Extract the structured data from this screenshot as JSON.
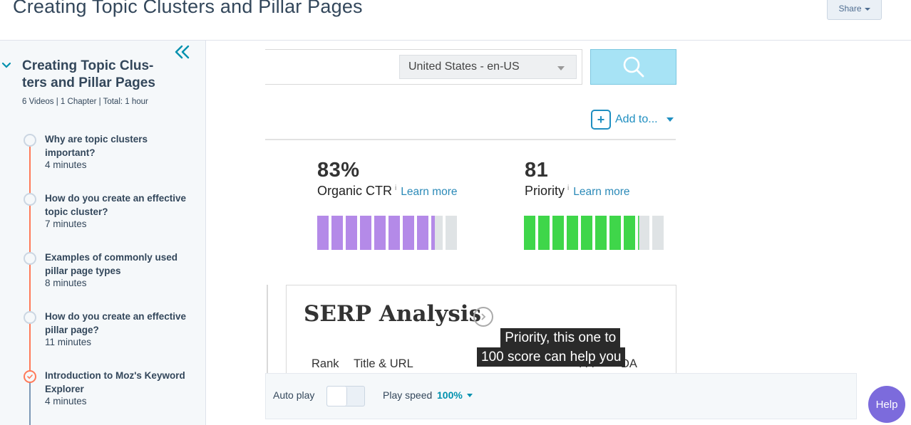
{
  "header": {
    "title": "Creating Topic Clusters and Pillar Pages",
    "share_label": "Share"
  },
  "sidebar": {
    "course_title": "Creating Topic Clus-ters and Pillar Pages",
    "course_title_line1": "Creating Topic Clus-",
    "course_title_line2": "ters and Pillar Pages",
    "meta": "6 Videos | 1 Chapter | Total: 1 hour",
    "lessons": [
      {
        "title": "Why are topic clusters important?",
        "duration": "4 minutes",
        "status": "pending"
      },
      {
        "title": "How do you create an effective topic cluster?",
        "duration": "7 minutes",
        "status": "pending"
      },
      {
        "title": "Examples of commonly used pillar page types",
        "duration": "8 minutes",
        "status": "pending"
      },
      {
        "title": "How do you create an effective pillar page?",
        "duration": "11 minutes",
        "status": "pending"
      },
      {
        "title": "Introduction to Moz's Keyword Explorer",
        "duration": "4 minutes",
        "status": "current"
      }
    ]
  },
  "video": {
    "locale": "United States - en-US",
    "add_to_label": "Add to...",
    "metrics": [
      {
        "value": "83%",
        "label": "Organic CTR",
        "info": "i",
        "learn_more": "Learn more",
        "level": 0.83,
        "color": "#b48ae8"
      },
      {
        "value": "81",
        "label": "Priority",
        "info": "i",
        "learn_more": "Learn more",
        "level": 0.81,
        "color": "#3fd64a"
      }
    ],
    "serp_title": "SERP Analysis",
    "columns": [
      "Rank",
      "Title & URL",
      "PA",
      "DA"
    ],
    "subtitle_line1": "Priority, this one to",
    "subtitle_line2": "100 score can help you"
  },
  "controls": {
    "autoplay_label": "Auto play",
    "autoplay_on": false,
    "speed_label": "Play speed",
    "speed_value": "100%"
  },
  "help_label": "Help",
  "colors": {
    "accent_orange": "#ff7a59",
    "link_blue": "#0091ae",
    "help_purple": "#7c6bdc"
  }
}
